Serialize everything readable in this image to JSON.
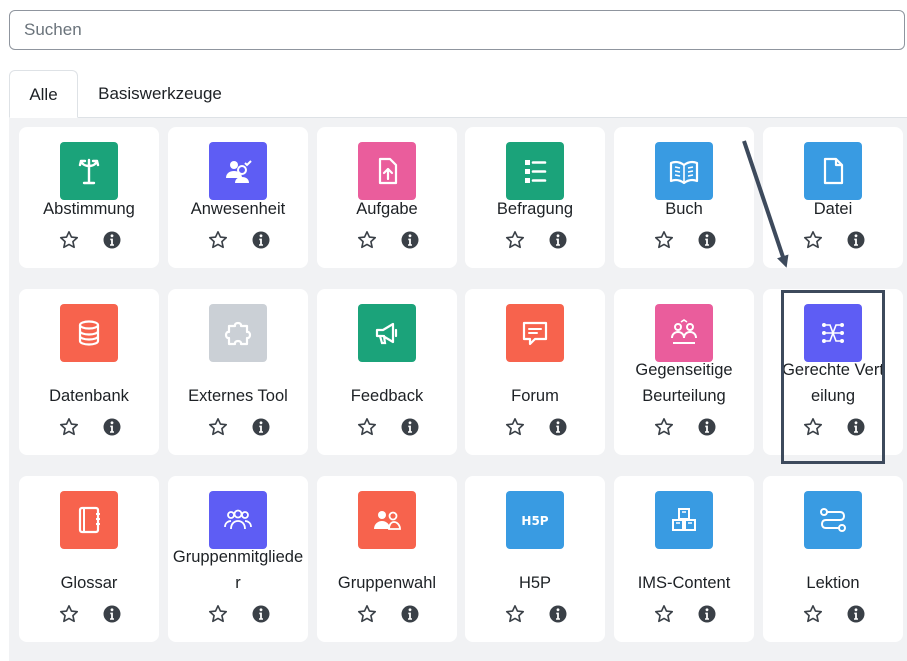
{
  "search": {
    "placeholder": "Suchen"
  },
  "tabs": [
    {
      "label": "Alle",
      "active": true
    },
    {
      "label": "Basiswerkzeuge",
      "active": false
    }
  ],
  "modules": [
    {
      "name": "Abstimmung",
      "icon": "signpost-icon",
      "color": "#1ba37a"
    },
    {
      "name": "Anwesenheit",
      "icon": "people-check-icon",
      "color": "#5e5df4"
    },
    {
      "name": "Aufgabe",
      "icon": "file-upload-icon",
      "color": "#ea5d9c"
    },
    {
      "name": "Befragung",
      "icon": "checklist-icon",
      "color": "#1ba37a"
    },
    {
      "name": "Buch",
      "icon": "open-book-icon",
      "color": "#399be2"
    },
    {
      "name": "Datei",
      "icon": "document-icon",
      "color": "#399be2"
    },
    {
      "name": "Datenbank",
      "icon": "database-icon",
      "color": "#f7634d"
    },
    {
      "name": "Externes Tool",
      "icon": "puzzle-icon",
      "color": "#cbd0d6"
    },
    {
      "name": "Feedback",
      "icon": "megaphone-icon",
      "color": "#1ba37a"
    },
    {
      "name": "Forum",
      "icon": "chat-icon",
      "color": "#f7634d"
    },
    {
      "name": "Gegenseitige Beurteilung",
      "icon": "peer-review-icon",
      "color": "#ea5d9c"
    },
    {
      "name": "Gerechte Verteilung",
      "icon": "distribution-icon",
      "color": "#5e5df4"
    },
    {
      "name": "Glossar",
      "icon": "notebook-icon",
      "color": "#f7634d"
    },
    {
      "name": "Gruppenmitglieder",
      "icon": "group-members-icon",
      "color": "#5e5df4"
    },
    {
      "name": "Gruppenwahl",
      "icon": "group-choice-icon",
      "color": "#f7634d"
    },
    {
      "name": "H5P",
      "icon": "h5p-icon",
      "color": "#399be2"
    },
    {
      "name": "IMS-Content",
      "icon": "package-icon",
      "color": "#399be2"
    },
    {
      "name": "Lektion",
      "icon": "path-icon",
      "color": "#399be2"
    }
  ],
  "card_icons": {
    "favourite": "star-icon",
    "info": "info-icon"
  },
  "annotation": {
    "color": "#3d4a5c"
  }
}
